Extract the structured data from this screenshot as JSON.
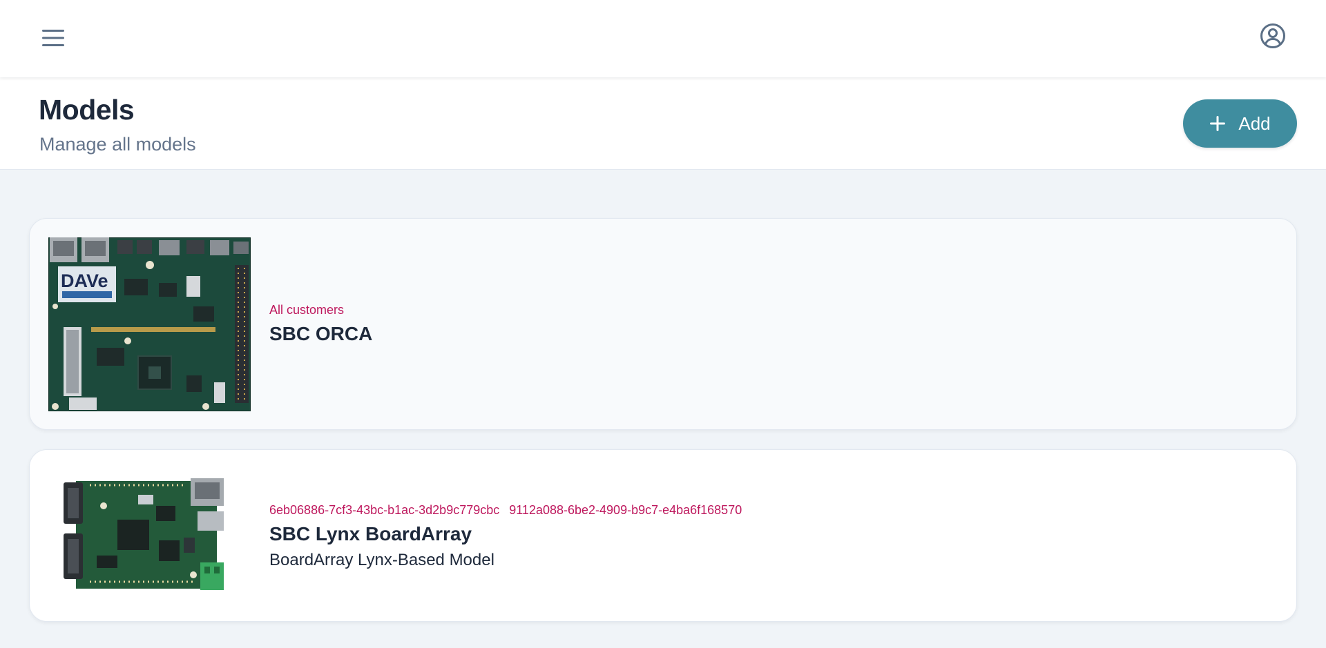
{
  "header": {
    "menu_icon": "hamburger-menu-icon",
    "account_icon": "account-circle-icon"
  },
  "page": {
    "title": "Models",
    "subtitle": "Manage all models",
    "add_button_label": "Add",
    "add_icon": "plus-icon"
  },
  "models": [
    {
      "tags": [
        "All customers"
      ],
      "name": "SBC ORCA",
      "description": ""
    },
    {
      "tags": [
        "6eb06886-7cf3-43bc-b1ac-3d2b9c779cbc",
        "9112a088-6be2-4909-b9c7-e4ba6f168570"
      ],
      "name": "SBC Lynx BoardArray",
      "description": "BoardArray Lynx-Based Model"
    }
  ],
  "colors": {
    "accent": "#3f8d9f",
    "tag_text": "#be185d",
    "title_text": "#1e293b",
    "muted_text": "#64748b",
    "background": "#f0f4f8"
  }
}
